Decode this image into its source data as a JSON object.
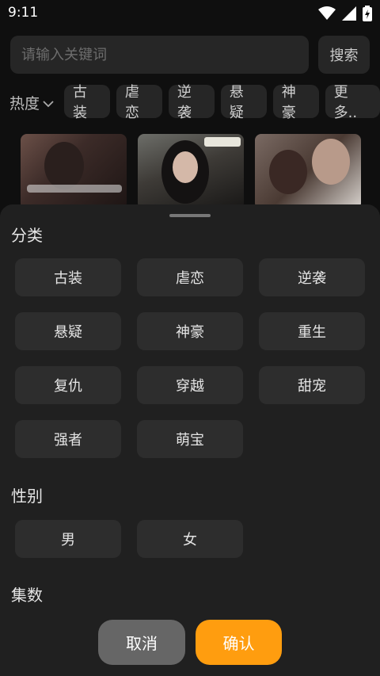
{
  "status_bar": {
    "time": "9:11",
    "icons": [
      "wifi-icon",
      "signal-icon",
      "battery-charging-icon"
    ]
  },
  "search": {
    "placeholder": "请输入关键词",
    "button_label": "搜索"
  },
  "sort": {
    "label": "热度",
    "icon": "chevron-down-icon"
  },
  "filter_chips": [
    "古装",
    "虐恋",
    "逆袭",
    "悬疑",
    "神豪",
    "更多.."
  ],
  "thumbnails": [
    {
      "name": "drama-thumb-1"
    },
    {
      "name": "drama-thumb-2"
    },
    {
      "name": "drama-thumb-3"
    }
  ],
  "sheet": {
    "category": {
      "title": "分类",
      "options": [
        "古装",
        "虐恋",
        "逆袭",
        "悬疑",
        "神豪",
        "重生",
        "复仇",
        "穿越",
        "甜宠",
        "强者",
        "萌宝"
      ]
    },
    "gender": {
      "title": "性别",
      "options": [
        "男",
        "女"
      ]
    },
    "episodes": {
      "title": "集数"
    },
    "cancel_label": "取消",
    "confirm_label": "确认"
  },
  "colors": {
    "accent": "#ff9d0f",
    "background": "#0f0f0f",
    "sheet": "#202020",
    "chip": "#262626",
    "cancel": "#666666"
  }
}
